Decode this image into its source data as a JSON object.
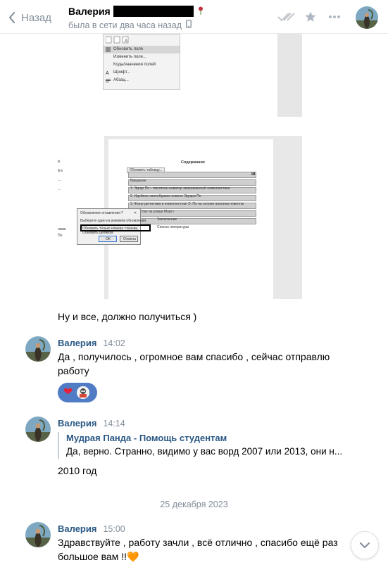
{
  "header": {
    "back_label": "Назад",
    "contact_name": "Валерия",
    "contact_status": "была в сети два часа назад",
    "icons": [
      "double-check-icon",
      "star-icon",
      "more-icon"
    ]
  },
  "colors": {
    "accent": "#2a5885",
    "muted": "#818c99",
    "reaction_bg": "#4f7cc5"
  },
  "images": {
    "context_menu": {
      "items": [
        "Обновить поле",
        "Изменить поле...",
        "Коды/значения полей",
        "Шрифт...",
        "Абзац..."
      ]
    },
    "doc": {
      "heading": "Содержание",
      "left_text": [
        "й",
        "й в",
        "...",
        "...",
        "ниже",
        "По"
      ],
      "toc_tooltip": "Обновить таблицу...",
      "toc_lines": [
        "Введение",
        "1. Эдгар По – писатель-новатор американской новеллистики",
        "2. Идейное своеобразие новелл Эдгара По",
        "3. Жанр детектива в новеллистике Э. По на основе анализа новеллы",
        "«Убийство на улице Морг»",
        "Заключение",
        "Список литературы"
      ],
      "toc_pages": [
        "3",
        "5",
        "9",
        "",
        "13",
        "17",
        "18"
      ],
      "dialog_title": "Обновление оглавления",
      "dialog_help": "?",
      "dialog_close": "✕",
      "dialog_prompt": "Выберите один из режимов обновления:",
      "dialog_option1": "Обновить только номера страниц",
      "dialog_option2": "Обновить целиком",
      "dialog_ok": "ОК",
      "dialog_cancel": "Отмена"
    }
  },
  "messages": {
    "m0_text": "Ну и все, должно получиться )",
    "m1": {
      "sender": "Валерия",
      "time": "14:02",
      "line1": "Да , получилось , огромное вам спасибо , сейчас отправлю",
      "line2": "работу",
      "reaction": "❤"
    },
    "m2": {
      "sender": "Валерия",
      "time": "14:14",
      "quote_author": "Мудрая Панда - Помощь студентам",
      "quote_text": "Да, верно. Странно, видимо у вас ворд 2007 или 2013, они н...",
      "text": "2010 год"
    },
    "date_separator": "25 декабря 2023",
    "m3": {
      "sender": "Валерия",
      "time": "15:00",
      "line1": "Здравствуйте , работу зачли , всё отлично , спасибо ещё раз",
      "line2": "большое вам !!🧡"
    }
  }
}
